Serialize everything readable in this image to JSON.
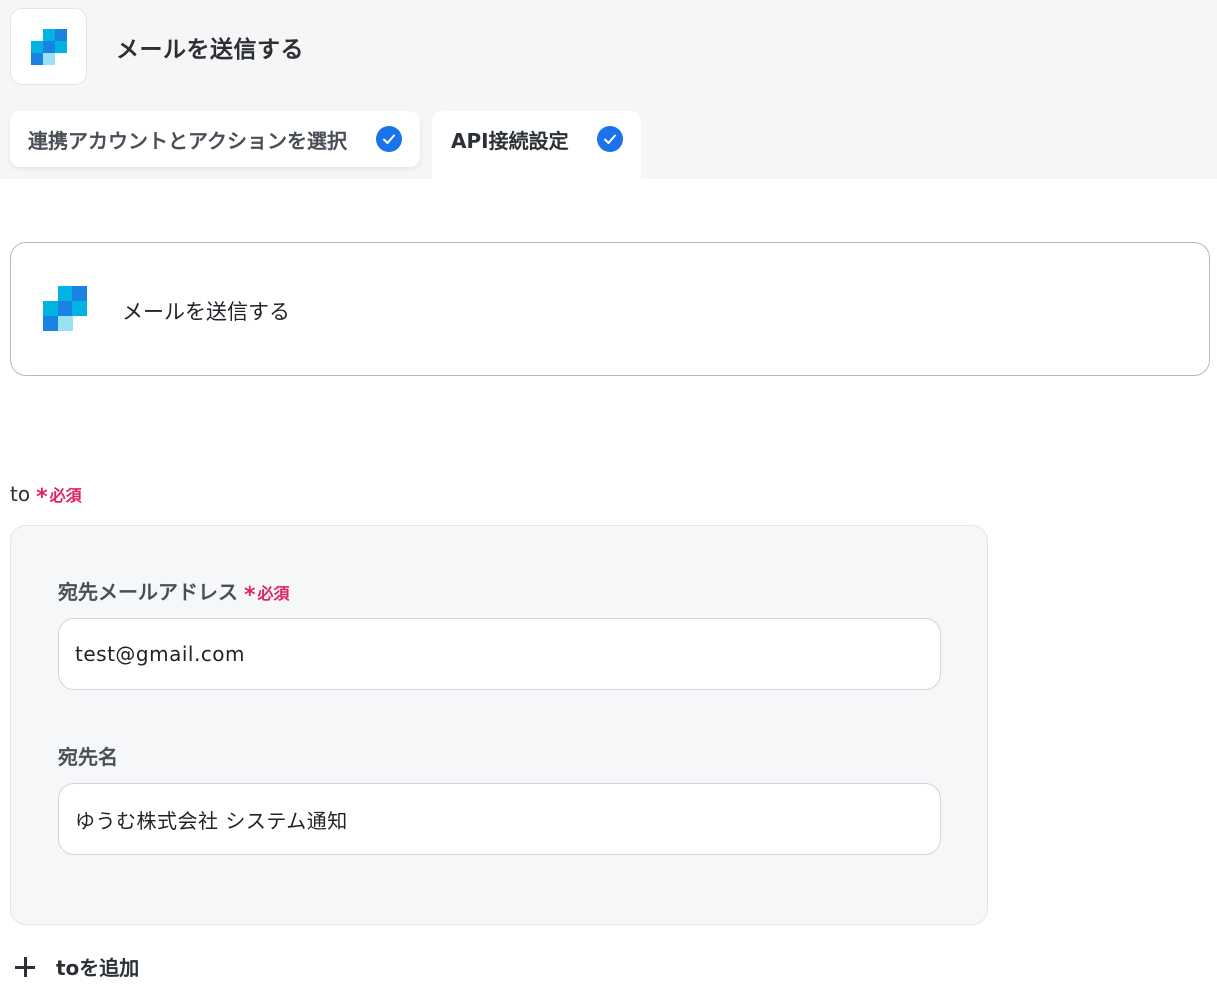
{
  "header": {
    "title": "メールを送信する",
    "logo_icon": "sendgrid-logo-icon"
  },
  "tabs": [
    {
      "label": "連携アカウントとアクションを選択",
      "status": "completed",
      "icon": "check-circle-icon"
    },
    {
      "label": "API接続設定",
      "status": "completed",
      "active": true,
      "icon": "check-circle-icon"
    }
  ],
  "action_card": {
    "title": "メールを送信する",
    "logo_icon": "sendgrid-logo-icon"
  },
  "to_field": {
    "label": "to",
    "required_mark": "*",
    "required_label": "必須",
    "recipient_email": {
      "label": "宛先メールアドレス",
      "required_mark": "*",
      "required_label": "必須",
      "value": "test@gmail.com"
    },
    "recipient_name": {
      "label": "宛先名",
      "value": "ゆうむ株式会社 システム通知"
    },
    "add_label": "toを追加"
  },
  "colors": {
    "accent": "#1a73e8",
    "required": "#e0245e",
    "logo_dark": "#1a82e2",
    "logo_mid": "#00b3e3",
    "logo_light": "#99e1f4"
  }
}
